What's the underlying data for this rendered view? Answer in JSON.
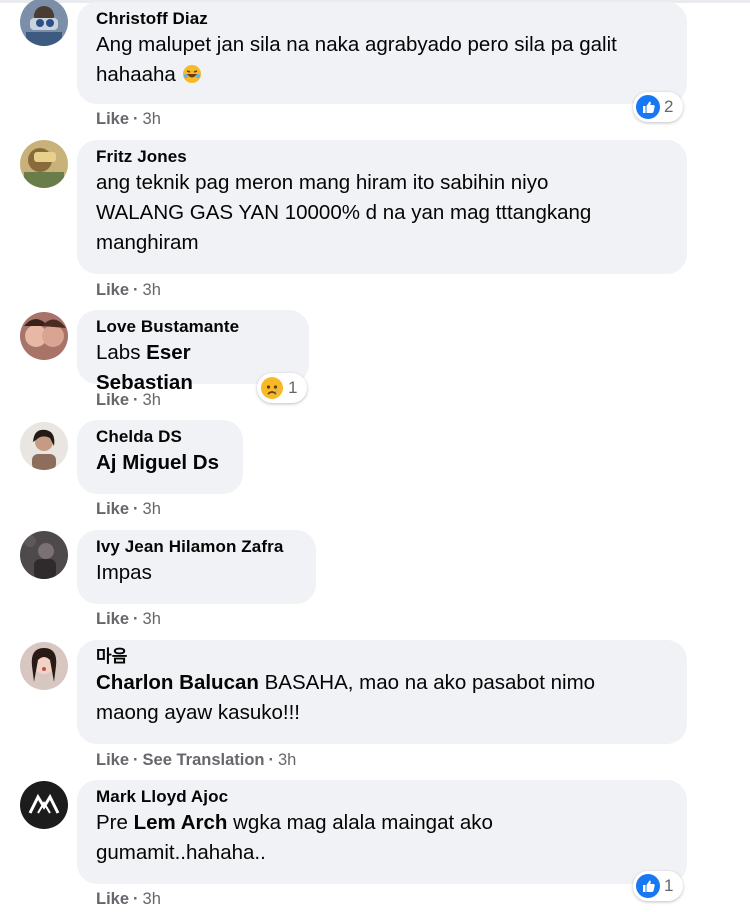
{
  "comments": [
    {
      "author": "Christoff Diaz",
      "line1": "Ang malupet jan sila na naka agrabyado pero sila pa galit",
      "line2": "hahaaha",
      "emoji": "laughing-emoji-icon",
      "reaction": {
        "icon": "like-reaction-icon",
        "count": "2"
      },
      "like": "Like",
      "time": "3h"
    },
    {
      "author": "Fritz Jones",
      "line1": "ang teknik pag meron mang hiram ito sabihin niyo",
      "line2": "WALANG GAS YAN 10000% d na yan mag tttangkang",
      "line3": "manghiram",
      "like": "Like",
      "time": "3h"
    },
    {
      "author": "Love Bustamante",
      "prefix": "Labs",
      "mention": "Eser Sebastian",
      "reaction": {
        "icon": "sad-reaction-icon",
        "count": "1"
      },
      "like": "Like",
      "time": "3h"
    },
    {
      "author": "Chelda DS",
      "mention": "Aj Miguel Ds",
      "like": "Like",
      "time": "3h"
    },
    {
      "author": "Ivy Jean Hilamon Zafra",
      "line1": "Impas",
      "like": "Like",
      "time": "3h"
    },
    {
      "author": "마음",
      "mention": "Charlon Balucan",
      "rest": "BASAHA, mao na ako pasabot nimo",
      "line2": "maong ayaw kasuko!!!",
      "like": "Like",
      "see_translation": "See Translation",
      "time": "3h"
    },
    {
      "author": "Mark Lloyd Ajoc",
      "prefix": "Pre",
      "mention": "Lem Arch",
      "rest": "wgka mag alala maingat ako",
      "line2": "gumamit..hahaha..",
      "reaction": {
        "icon": "like-reaction-icon",
        "count": "1"
      },
      "like": "Like",
      "time": "3h"
    }
  ],
  "colors": {
    "bubble": "#f0f2f5",
    "meta_text": "#65676b",
    "like_blue": "#1877f2",
    "sad_yellow": "#f7b928"
  }
}
